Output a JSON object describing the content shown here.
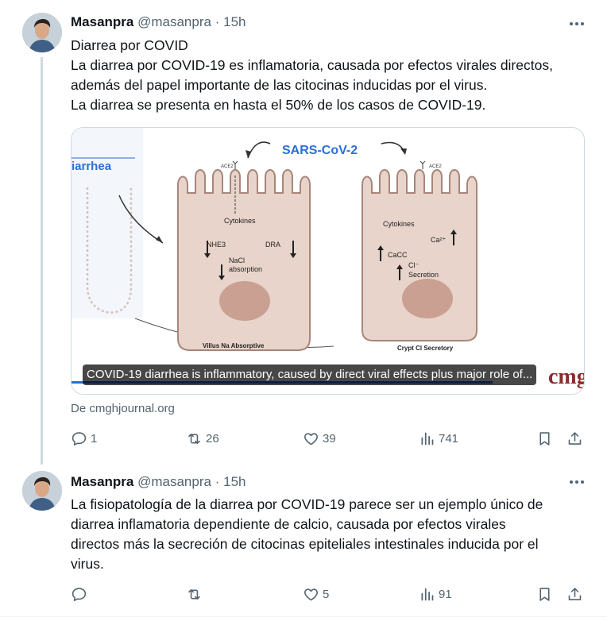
{
  "tweets": [
    {
      "author_name": "Masanpra",
      "author_handle": "@masanpra",
      "separator": "·",
      "time": "15h",
      "text": "Diarrea por COVID\nLa diarrea por COVID-19 es inflamatoria, causada por efectos virales directos,\nademás del papel importante de las citocinas inducidas por el virus.\nLa diarrea se presenta en hasta el 50% de los casos de COVID-19.",
      "card": {
        "image_title": "SARS-CoV-2",
        "side_label": "iarrhea",
        "left_cell": {
          "receptor": "ACE2",
          "cytokines": "Cytokines",
          "nhe3": "NHE3",
          "dra": "DRA",
          "nacl1": "NaCl",
          "nacl2": "absorption",
          "label": "Villus Na Absorptive"
        },
        "right_cell": {
          "receptor": "ACE2",
          "cytokines": "Cytokines",
          "ca": "Ca²⁺",
          "cacc": "CaCC",
          "cl1": "Cl⁻",
          "cl2": "Secretion",
          "label": "Crypt Cl Secretory"
        },
        "logo": "cmg",
        "caption": "COVID-19 diarrhea is inflammatory, caused by direct viral effects plus major role of...",
        "source": "De cmghjournal.org"
      },
      "replies": "1",
      "reposts": "26",
      "likes": "39",
      "views": "741"
    },
    {
      "author_name": "Masanpra",
      "author_handle": "@masanpra",
      "separator": "·",
      "time": "15h",
      "text": "La fisiopatología de la diarrea por COVID-19 parece ser un ejemplo único de\ndiarrea inflamatoria dependiente de calcio, causada por efectos virales\ndirectos más la secreción de citocinas epiteliales intestinales inducida por el\nvirus.",
      "replies": "",
      "reposts": "",
      "likes": "5",
      "views": "91"
    }
  ],
  "colors": {
    "text": "#0f1419",
    "secondary": "#536471",
    "border": "#cfd9de",
    "cell_fill": "#e8d4ca",
    "cell_stroke": "#a8867a",
    "nucleus": "#c9a091",
    "title_blue": "#2a6fd6"
  },
  "icons": {
    "reply": "reply-icon",
    "repost": "repost-icon",
    "like": "heart-icon",
    "views": "analytics-icon",
    "bookmark": "bookmark-icon",
    "share": "share-icon",
    "more": "more-icon"
  }
}
